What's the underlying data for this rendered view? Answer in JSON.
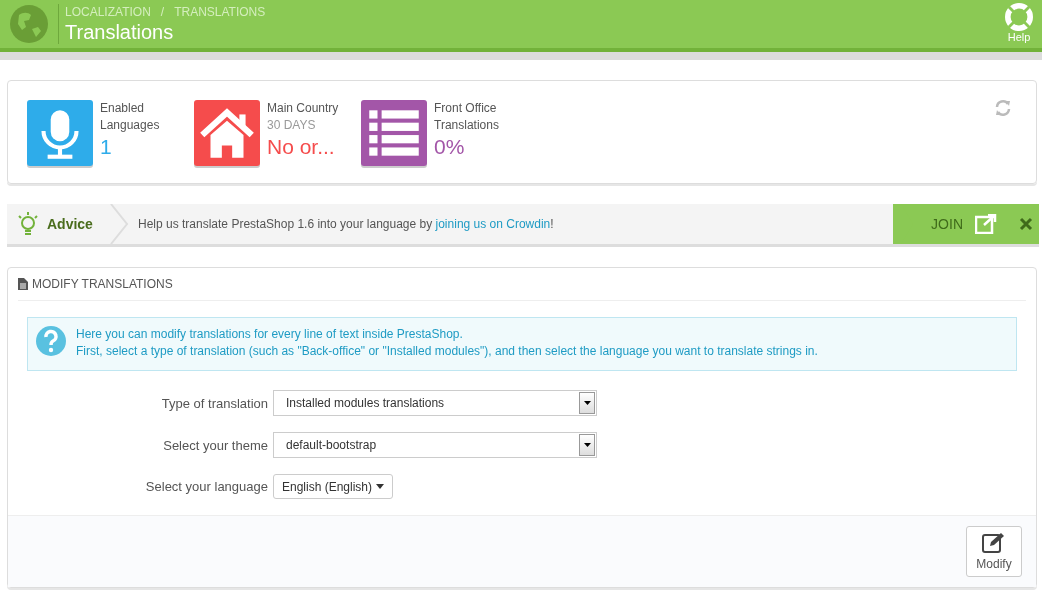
{
  "header": {
    "breadcrumb": [
      "LOCALIZATION",
      "TRANSLATIONS"
    ],
    "breadcrumb_separator": "/",
    "title": "Translations",
    "help": "Help"
  },
  "kpis": [
    {
      "kind": "microphone",
      "color": "#2eacea",
      "label": "Enabled Languages",
      "value": "1"
    },
    {
      "kind": "house",
      "color": "#f54c4c",
      "label": "Main Country",
      "sublabel": "30 DAYS",
      "value": "No or..."
    },
    {
      "kind": "list",
      "color": "#a356a8",
      "label": "Front Office Translations",
      "value": "0%"
    }
  ],
  "advice": {
    "title": "Advice",
    "text_before": "Help us translate PrestaShop 1.6 into your language by ",
    "link": "joining us on Crowdin",
    "text_after": "!",
    "join": "JOIN"
  },
  "panel": {
    "title": "MODIFY TRANSLATIONS",
    "info": [
      "Here you can modify translations for every line of text inside PrestaShop.",
      "First, select a type of translation (such as \"Back-office\" or \"Installed modules\"), and then select the language you want to translate strings in."
    ],
    "fields": [
      {
        "kind": "select",
        "label": "Type of translation",
        "value": "Installed modules translations"
      },
      {
        "kind": "select",
        "label": "Select your theme",
        "value": "default-bootstrap"
      },
      {
        "kind": "dropdown",
        "label": "Select your language",
        "value": "English (English)"
      }
    ],
    "button": "Modify"
  }
}
